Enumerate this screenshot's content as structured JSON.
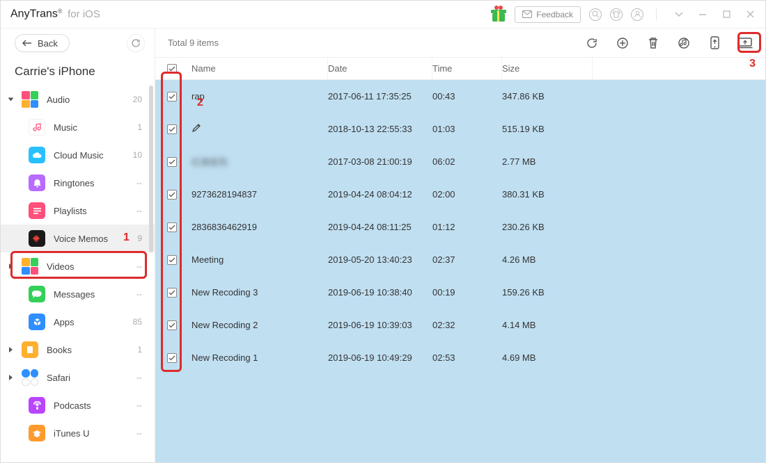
{
  "titlebar": {
    "brand": "AnyTrans",
    "sup": "®",
    "sub": "for iOS",
    "feedback_label": "Feedback"
  },
  "sidebar": {
    "back_label": "Back",
    "device_name": "Carrie's iPhone",
    "items": [
      {
        "label": "Audio",
        "count": "20",
        "type": "group",
        "expanded": true
      },
      {
        "label": "Music",
        "count": "1",
        "type": "child",
        "icon_bg": "#ffffff",
        "icon_svg": "music-note"
      },
      {
        "label": "Cloud Music",
        "count": "10",
        "type": "child",
        "icon_bg": "#29c0ff",
        "icon_svg": "cloud"
      },
      {
        "label": "Ringtones",
        "count": "--",
        "type": "child",
        "icon_bg": "#b86bff",
        "icon_svg": "bell"
      },
      {
        "label": "Playlists",
        "count": "--",
        "type": "child",
        "icon_bg": "#ff4f7a",
        "icon_svg": "list"
      },
      {
        "label": "Voice Memos",
        "count": "9",
        "type": "child",
        "icon_bg": "#1a1a1a",
        "icon_svg": "voice",
        "active": true
      },
      {
        "label": "Videos",
        "count": "--",
        "type": "group"
      },
      {
        "label": "Messages",
        "count": "--",
        "type": "child",
        "icon_bg": "#34d058",
        "icon_svg": "chat"
      },
      {
        "label": "Apps",
        "count": "85",
        "type": "child",
        "icon_bg": "#2f8fff",
        "icon_svg": "apps"
      },
      {
        "label": "Books",
        "count": "1",
        "type": "group"
      },
      {
        "label": "Safari",
        "count": "--",
        "type": "group",
        "quad_style": "safari"
      },
      {
        "label": "Podcasts",
        "count": "--",
        "type": "child",
        "icon_bg": "#b946ff",
        "icon_svg": "podcast"
      },
      {
        "label": "iTunes U",
        "count": "--",
        "type": "child",
        "icon_bg": "#ff9b2e",
        "icon_svg": "grad"
      }
    ]
  },
  "toolbar": {
    "total_text": "Total 9 items"
  },
  "columns": {
    "name": "Name",
    "date": "Date",
    "time": "Time",
    "size": "Size"
  },
  "rows": [
    {
      "name": "rap",
      "date": "2017-06-11 17:35:25",
      "time": "00:43",
      "size": "347.86 KB"
    },
    {
      "name": "",
      "pencil": true,
      "date": "2018-10-13 22:55:33",
      "time": "01:03",
      "size": "515.19 KB"
    },
    {
      "name": "红旗医院",
      "blur": true,
      "date": "2017-03-08 21:00:19",
      "time": "06:02",
      "size": "2.77 MB"
    },
    {
      "name": "9273628194837",
      "date": "2019-04-24 08:04:12",
      "time": "02:00",
      "size": "380.31 KB"
    },
    {
      "name": "2836836462919",
      "date": "2019-04-24 08:11:25",
      "time": "01:12",
      "size": "230.26 KB"
    },
    {
      "name": "Meeting",
      "date": "2019-05-20 13:40:23",
      "time": "02:37",
      "size": "4.26 MB"
    },
    {
      "name": "New Recoding 3",
      "date": "2019-06-19 10:38:40",
      "time": "00:19",
      "size": "159.26 KB"
    },
    {
      "name": "New Recoding 2",
      "date": "2019-06-19 10:39:03",
      "time": "02:32",
      "size": "4.14 MB"
    },
    {
      "name": "New Recoding 1",
      "date": "2019-06-19 10:49:29",
      "time": "02:53",
      "size": "4.69 MB"
    }
  ],
  "annotations": {
    "n1": "1",
    "n2": "2",
    "n3": "3"
  }
}
